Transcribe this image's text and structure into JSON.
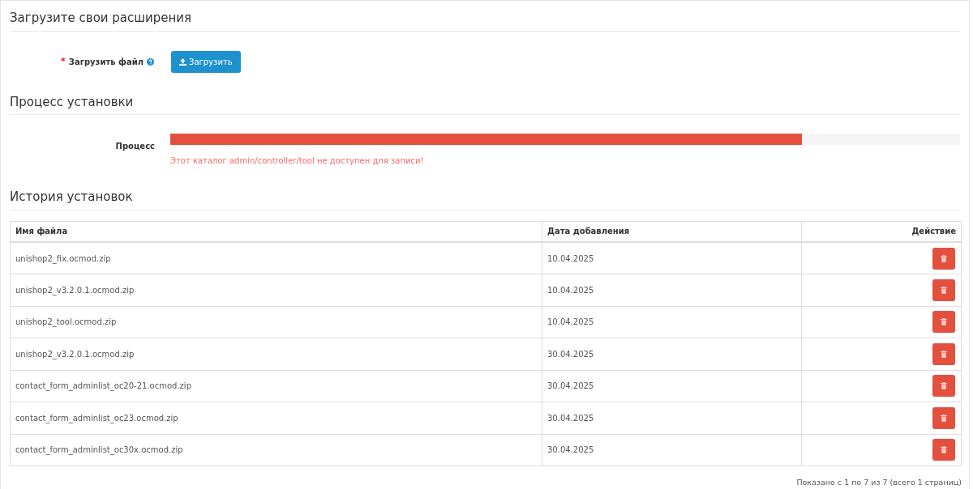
{
  "upload_section": {
    "title": "Загрузите свои расширения",
    "field_label": "Загрузить файл",
    "required_mark": "*",
    "button": "Загрузить"
  },
  "install_section": {
    "title": "Процесс установки",
    "label": "Процесс",
    "progress": {
      "level": 0.8
    },
    "error": "Этот каталог admin/controller/tool не доступен для записи!"
  },
  "history_section": {
    "title": "История установок",
    "table": {
      "columns": [
        "Имя файла",
        "Дата добавления",
        "Действие"
      ],
      "rows": [
        {
          "filename": "unishop2_fix.ocmod.zip",
          "date": "10.04.2025"
        },
        {
          "filename": "unishop2_v3.2.0.1.ocmod.zip",
          "date": "10.04.2025"
        },
        {
          "filename": "unishop2_tool.ocmod.zip",
          "date": "10.04.2025"
        },
        {
          "filename": "unishop2_v3.2.0.1.ocmod.zip",
          "date": "30.04.2025"
        },
        {
          "filename": "contact_form_adminlist_oc20-21.ocmod.zip",
          "date": "30.04.2025"
        },
        {
          "filename": "contact_form_adminlist_oc23.ocmod.zip",
          "date": "30.04.2025"
        },
        {
          "filename": "contact_form_adminlist_oc30x.ocmod.zip",
          "date": "30.04.2025"
        }
      ]
    },
    "pagination_text": "Показано с 1 по 7 из 7 (всего 1 страниц)"
  }
}
